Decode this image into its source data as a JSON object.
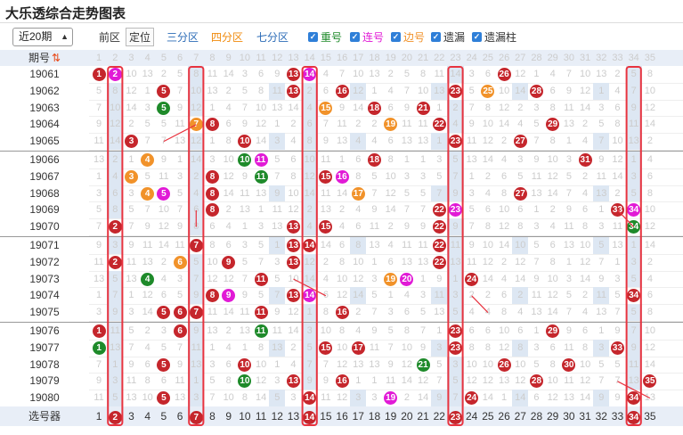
{
  "title": "大乐透综合走势图表",
  "toolbar": {
    "period_value": "近20期",
    "front_label": "前区",
    "position_label": "定位",
    "zone3_label": "三分区",
    "zone4_label": "四分区",
    "zone7_label": "七分区",
    "chk_repeat": "重号",
    "chk_consecutive": "连号",
    "chk_edge": "边号",
    "chk_miss": "遗漏",
    "chk_miss_bar": "遗漏柱"
  },
  "header": {
    "issue_label": "期号",
    "numbers": [
      "1",
      "2",
      "3",
      "4",
      "5",
      "6",
      "7",
      "8",
      "9",
      "10",
      "11",
      "12",
      "13",
      "14",
      "15",
      "16",
      "17",
      "18",
      "19",
      "20",
      "21",
      "22",
      "23",
      "24",
      "25",
      "26",
      "27",
      "28",
      "29",
      "30",
      "31",
      "32",
      "33",
      "34",
      "35"
    ]
  },
  "footer": {
    "label": "选号器",
    "numbers": [
      "1",
      "2",
      "3",
      "4",
      "5",
      "6",
      "7",
      "8",
      "9",
      "10",
      "11",
      "12",
      "13",
      "14",
      "15",
      "16",
      "17",
      "18",
      "19",
      "20",
      "21",
      "22",
      "23",
      "24",
      "25",
      "26",
      "27",
      "28",
      "29",
      "30",
      "31",
      "32",
      "33",
      "34",
      "35"
    ],
    "selected": [
      2,
      7,
      14,
      23,
      34
    ]
  },
  "colors": {
    "red": "#c5262c",
    "green": "#1e8a2a",
    "orange": "#f1922a",
    "magenta": "#e11ad6",
    "highlight": "#e8333f",
    "header_bg": "#e8eef7"
  },
  "rows": [
    {
      "issue": "19061",
      "balls": {
        "1": "r",
        "2": "p",
        "13": "r",
        "14": "p",
        "26": "r"
      }
    },
    {
      "issue": "19062",
      "balls": {
        "5": "r",
        "13": "r",
        "16": "r",
        "23": "r",
        "25": "o",
        "28": "r"
      }
    },
    {
      "issue": "19063",
      "balls": {
        "5": "g",
        "15": "o",
        "18": "r",
        "21": "r"
      }
    },
    {
      "issue": "19064",
      "balls": {
        "7": "o",
        "8": "r",
        "19": "o",
        "22": "r",
        "29": "r"
      }
    },
    {
      "issue": "19065",
      "balls": {
        "3": "r",
        "10": "r",
        "23": "r",
        "27": "r"
      }
    },
    {
      "issue": "19066",
      "balls": {
        "4": "o",
        "10": "g",
        "11": "p",
        "18": "r",
        "31": "r"
      }
    },
    {
      "issue": "19067",
      "balls": {
        "3": "o",
        "8": "r",
        "11": "g",
        "15": "r",
        "16": "p"
      }
    },
    {
      "issue": "19068",
      "balls": {
        "4": "o",
        "5": "p",
        "8": "r",
        "17": "o",
        "27": "r"
      }
    },
    {
      "issue": "19069",
      "balls": {
        "8": "r",
        "22": "r",
        "23": "p",
        "33": "r",
        "34": "p"
      }
    },
    {
      "issue": "19070",
      "balls": {
        "2": "r",
        "13": "r",
        "15": "r",
        "22": "r",
        "34": "g"
      }
    },
    {
      "issue": "19071",
      "balls": {
        "7": "r",
        "13": "r",
        "14": "r",
        "22": "r"
      }
    },
    {
      "issue": "19072",
      "balls": {
        "2": "r",
        "6": "o",
        "9": "r",
        "13": "r",
        "22": "r"
      }
    },
    {
      "issue": "19073",
      "balls": {
        "4": "g",
        "11": "r",
        "19": "o",
        "20": "p",
        "24": "r"
      }
    },
    {
      "issue": "19074",
      "balls": {
        "8": "r",
        "9": "p",
        "13": "r",
        "14": "p",
        "34": "r"
      }
    },
    {
      "issue": "19075",
      "balls": {
        "5": "r",
        "6": "r",
        "7": "r",
        "11": "r",
        "16": "r"
      }
    },
    {
      "issue": "19076",
      "balls": {
        "1": "r",
        "6": "r",
        "11": "g",
        "23": "r",
        "29": "r"
      }
    },
    {
      "issue": "19077",
      "balls": {
        "1": "g",
        "15": "r",
        "17": "r",
        "23": "r",
        "33": "r"
      }
    },
    {
      "issue": "19078",
      "balls": {
        "5": "r",
        "10": "r",
        "21": "g",
        "26": "r",
        "30": "r"
      }
    },
    {
      "issue": "19079",
      "balls": {
        "10": "g",
        "13": "r",
        "16": "r",
        "28": "r",
        "35": "r"
      }
    },
    {
      "issue": "19080",
      "balls": {
        "5": "r",
        "14": "r",
        "19": "p",
        "24": "r",
        "34": "r"
      }
    }
  ]
}
